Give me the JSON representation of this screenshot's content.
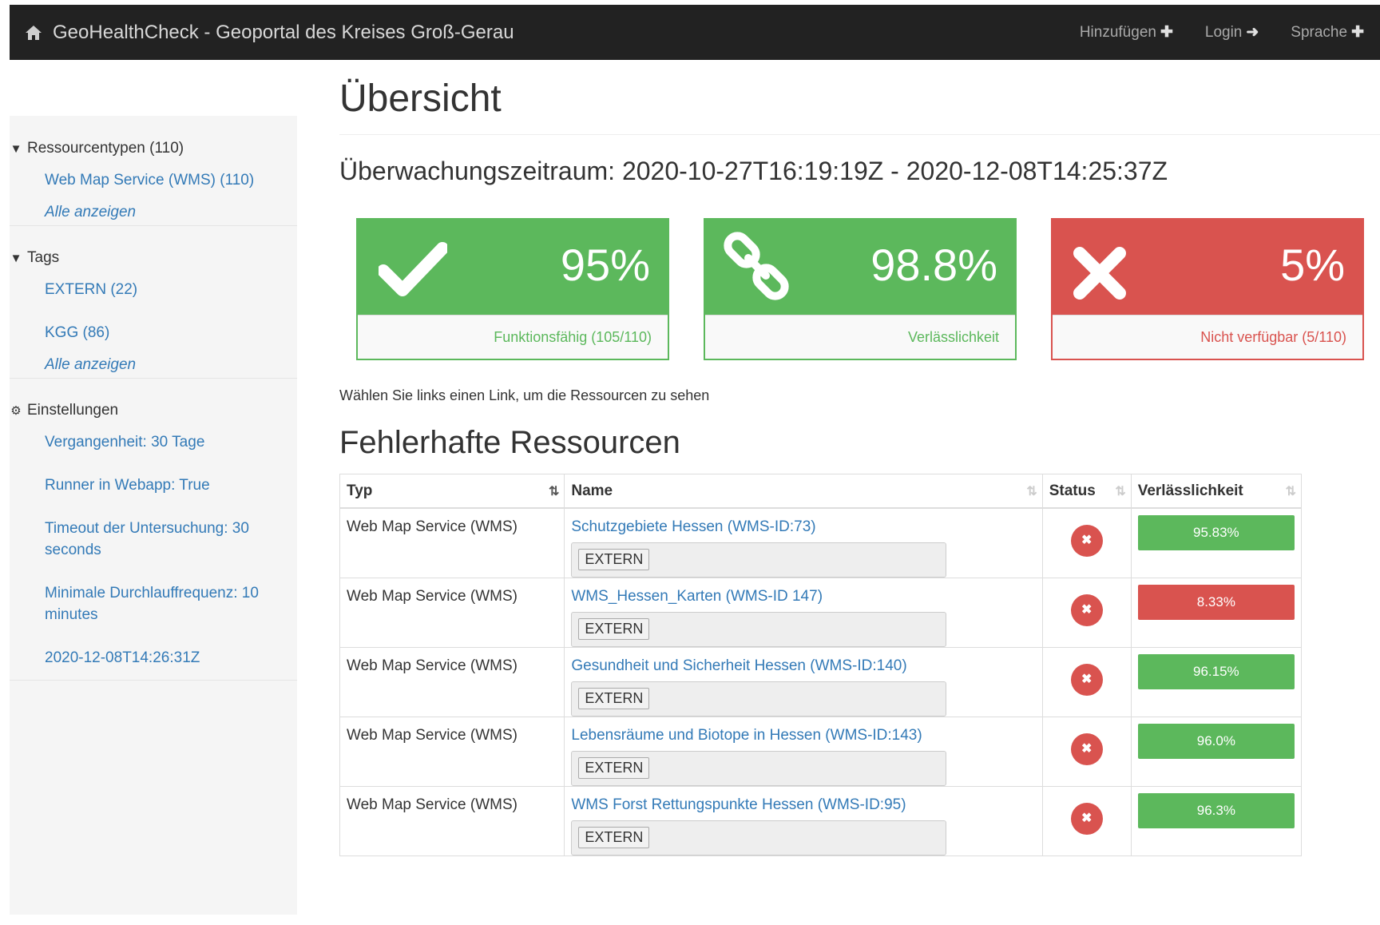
{
  "navbar": {
    "brand": "GeoHealthCheck - Geoportal des Kreises Groß-Gerau",
    "links": [
      {
        "label": "Hinzufügen",
        "icon": "plus-icon"
      },
      {
        "label": "Login",
        "icon": "sign-in-icon"
      },
      {
        "label": "Sprache",
        "icon": "plus-icon"
      }
    ]
  },
  "sidebar": {
    "resource_types_heading": "Ressourcentypen (110)",
    "resource_types": [
      "Web Map Service (WMS) (110)"
    ],
    "resource_types_show_all": "Alle anzeigen",
    "tags_heading": "Tags",
    "tags": [
      "EXTERN (22)",
      "KGG (86)"
    ],
    "tags_show_all": "Alle anzeigen",
    "settings_heading": "Einstellungen",
    "settings": [
      "Vergangenheit: 30 Tage",
      "Runner in Webapp: True",
      "Timeout der Untersuchung: 30 seconds",
      "Minimale Durchlauffrequenz: 10 minutes",
      "2020-12-08T14:26:31Z"
    ]
  },
  "main": {
    "title": "Übersicht",
    "period": "Überwachungszeitraum: 2020-10-27T16:19:19Z - 2020-12-08T14:25:37Z",
    "panels": [
      {
        "value": "95%",
        "label": "Funktionsfähig (105/110)",
        "icon": "check-icon",
        "color": "#5cb85c"
      },
      {
        "value": "98.8%",
        "label": "Verlässlichkeit",
        "icon": "link-icon",
        "color": "#5cb85c"
      },
      {
        "value": "5%",
        "label": "Nicht verfügbar (5/110)",
        "icon": "times-icon",
        "color": "#d9534f"
      }
    ],
    "hint": "Wählen Sie links einen Link, um die Ressourcen zu sehen",
    "errors_title": "Fehlerhafte Ressourcen",
    "table": {
      "headers": [
        "Typ",
        "Name",
        "Status",
        "Verlässlichkeit"
      ],
      "rows": [
        {
          "type": "Web Map Service (WMS)",
          "name": "Schutzgebiete Hessen (WMS-ID:73)",
          "tag": "EXTERN",
          "reliability": "95.83%",
          "reliability_color": "#5cb85c"
        },
        {
          "type": "Web Map Service (WMS)",
          "name": "WMS_Hessen_Karten (WMS-ID 147)",
          "tag": "EXTERN",
          "reliability": "8.33%",
          "reliability_color": "#d9534f"
        },
        {
          "type": "Web Map Service (WMS)",
          "name": "Gesundheit und Sicherheit Hessen (WMS-ID:140)",
          "tag": "EXTERN",
          "reliability": "96.15%",
          "reliability_color": "#5cb85c"
        },
        {
          "type": "Web Map Service (WMS)",
          "name": "Lebensräume und Biotope in Hessen (WMS-ID:143)",
          "tag": "EXTERN",
          "reliability": "96.0%",
          "reliability_color": "#5cb85c"
        },
        {
          "type": "Web Map Service (WMS)",
          "name": "WMS Forst Rettungspunkte Hessen (WMS-ID:95)",
          "tag": "EXTERN",
          "reliability": "96.3%",
          "reliability_color": "#5cb85c"
        }
      ]
    }
  }
}
